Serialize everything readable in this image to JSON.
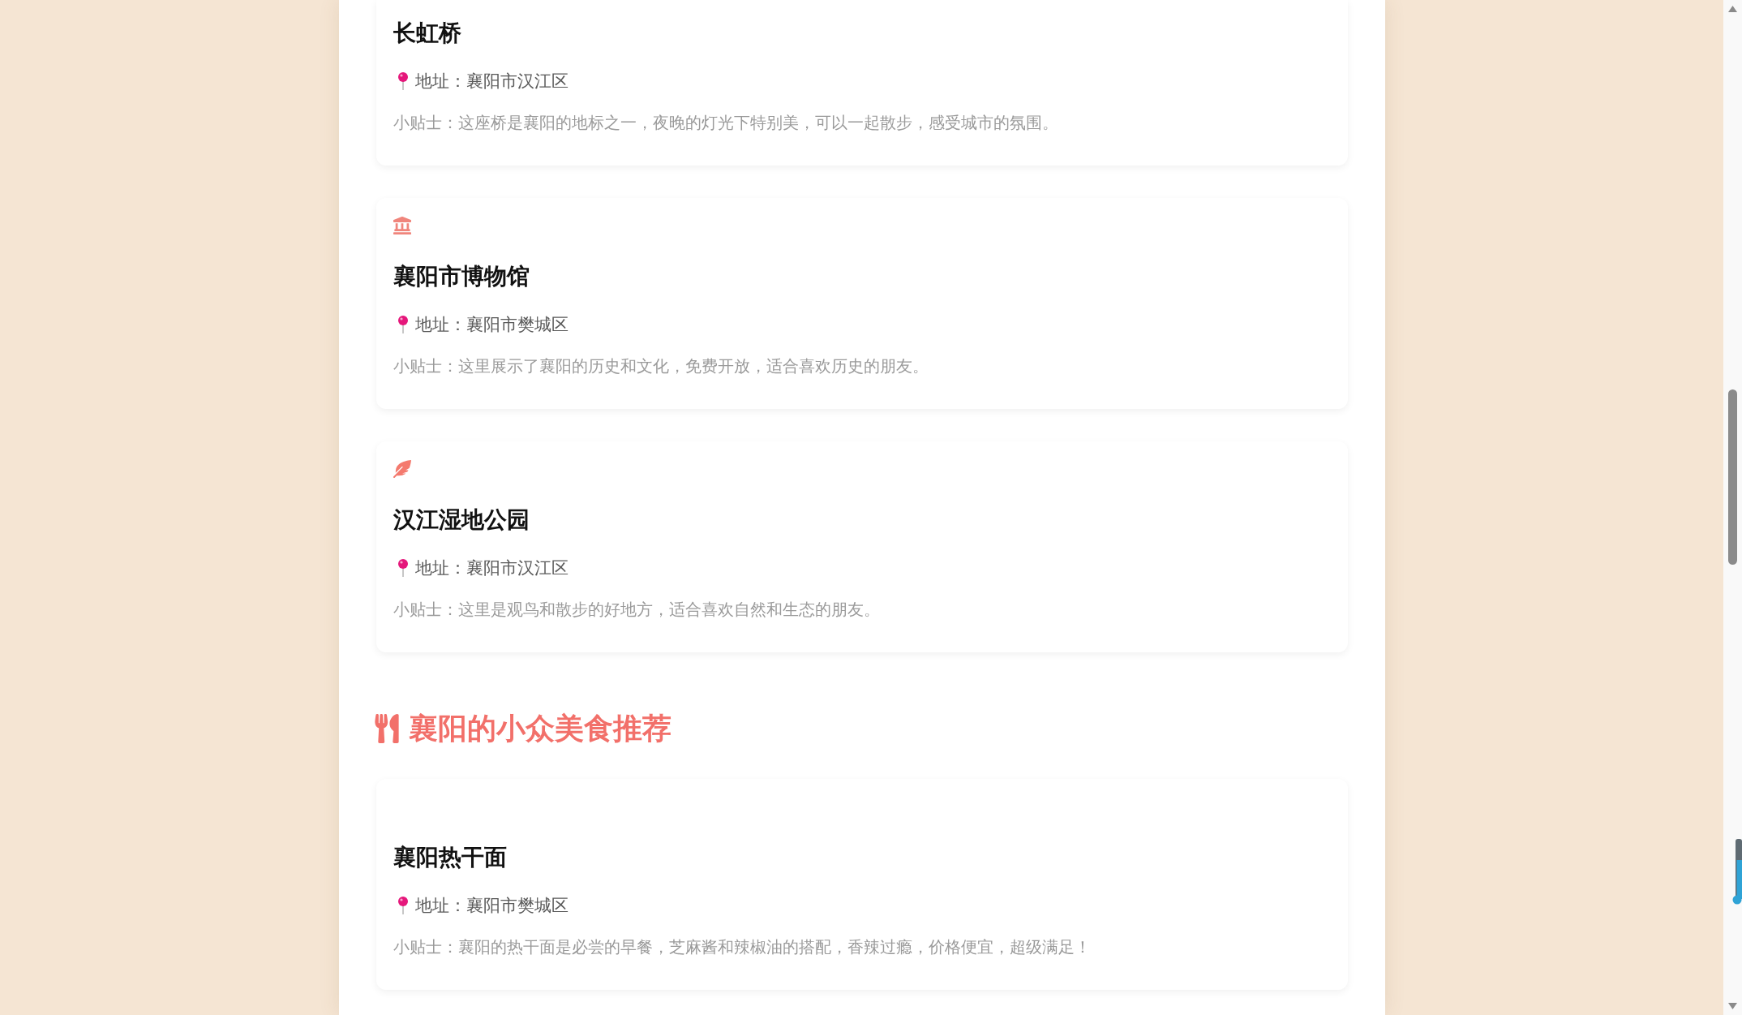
{
  "sections": [
    {
      "cards": [
        {
          "kind": "clipped",
          "title": "长虹桥",
          "address": "地址：襄阳市汉江区",
          "tip": "小贴士：这座桥是襄阳的地标之一，夜晚的灯光下特别美，可以一起散步，感受城市的氛围。"
        },
        {
          "kind": "museum",
          "title": "襄阳市博物馆",
          "address": "地址：襄阳市樊城区",
          "tip": "小贴士：这里展示了襄阳的历史和文化，免费开放，适合喜欢历史的朋友。"
        },
        {
          "kind": "nature",
          "title": "汉江湿地公园",
          "address": "地址：襄阳市汉江区",
          "tip": "小贴士：这里是观鸟和散步的好地方，适合喜欢自然和生态的朋友。"
        }
      ]
    },
    {
      "heading": "襄阳的小众美食推荐",
      "cards": [
        {
          "kind": "blank",
          "title": "襄阳热干面",
          "address": "地址：襄阳市樊城区",
          "tip": "小贴士：襄阳的热干面是必尝的早餐，芝麻酱和辣椒油的搭配，香辣过瘾，价格便宜，超级满足！"
        }
      ]
    }
  ]
}
